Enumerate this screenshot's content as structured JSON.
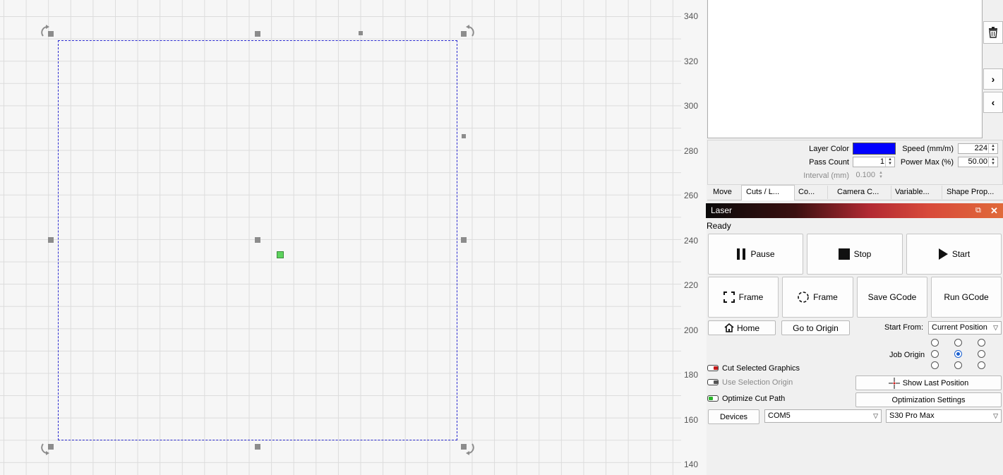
{
  "ruler": {
    "labels": [
      "340",
      "320",
      "300",
      "280",
      "260",
      "240",
      "220",
      "200",
      "180",
      "160",
      "140"
    ]
  },
  "layer_props": {
    "layer_color_label": "Layer Color",
    "layer_color": "#0000ff",
    "speed_label": "Speed (mm/m)",
    "speed_value": "224",
    "pass_count_label": "Pass Count",
    "pass_count_value": "1",
    "power_max_label": "Power Max (%)",
    "power_max_value": "50.00",
    "interval_label": "Interval (mm)",
    "interval_value": "0.100"
  },
  "tabs": [
    "Move",
    "Cuts / L...",
    "Co...",
    "Camera C...",
    "Variable...",
    "Shape Prop..."
  ],
  "laser": {
    "title": "Laser",
    "status": "Ready",
    "pause_label": "Pause",
    "stop_label": "Stop",
    "start_label": "Start",
    "frame_rect_label": "Frame",
    "frame_circle_label": "Frame",
    "save_gcode_label": "Save GCode",
    "run_gcode_label": "Run GCode",
    "home_label": "Home",
    "go_origin_label": "Go to Origin",
    "start_from_label": "Start From:",
    "start_from_value": "Current Position",
    "job_origin_label": "Job Origin",
    "cut_selected_label": "Cut Selected Graphics",
    "use_selection_origin_label": "Use Selection Origin",
    "optimize_cut_path_label": "Optimize Cut Path",
    "show_last_position_label": "Show Last Position",
    "optimization_settings_label": "Optimization Settings",
    "devices_label": "Devices",
    "port_value": "COM5",
    "device_value": "S30 Pro Max"
  }
}
